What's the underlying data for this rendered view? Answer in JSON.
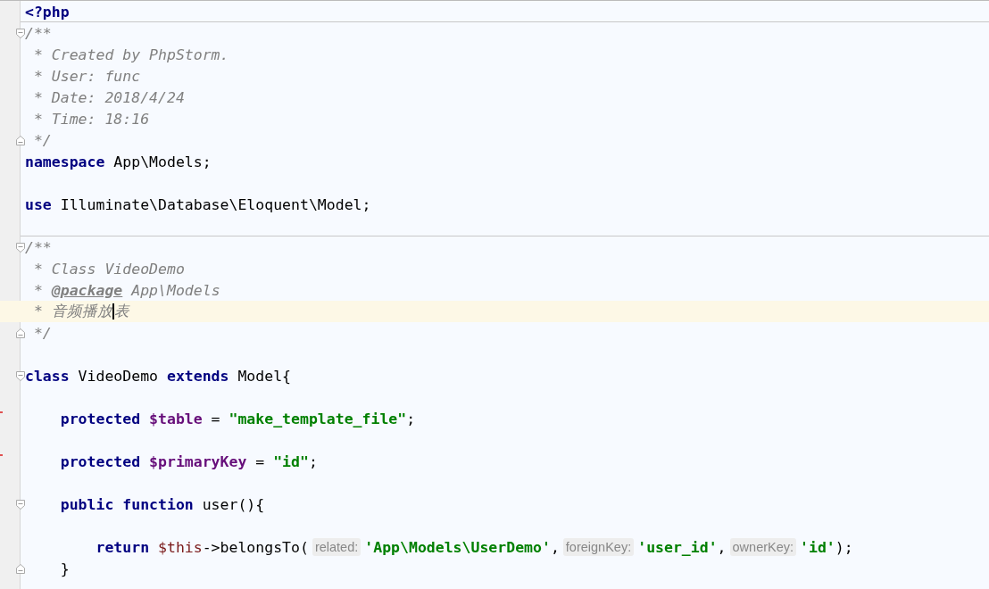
{
  "editor": {
    "lines": [
      {
        "separator_after": true,
        "tokens": [
          {
            "kind": "keyword",
            "text": "<?php"
          }
        ]
      },
      {
        "fold_start": true,
        "tokens": [
          {
            "kind": "comment",
            "text": "/**"
          }
        ]
      },
      {
        "tokens": [
          {
            "kind": "comment",
            "text": " * Created by PhpStorm."
          }
        ]
      },
      {
        "tokens": [
          {
            "kind": "comment",
            "text": " * User: func"
          }
        ]
      },
      {
        "tokens": [
          {
            "kind": "comment",
            "text": " * Date: 2018/4/24"
          }
        ]
      },
      {
        "tokens": [
          {
            "kind": "comment",
            "text": " * Time: 18:16"
          }
        ]
      },
      {
        "fold_end": true,
        "tokens": [
          {
            "kind": "comment",
            "text": " */"
          }
        ]
      },
      {
        "blank_after": true,
        "tokens": [
          {
            "kind": "keyword",
            "text": "namespace"
          },
          {
            "kind": "plain",
            "text": " App\\Models;"
          }
        ]
      },
      {
        "blank_after": true,
        "separator_after": true,
        "tokens": [
          {
            "kind": "keyword",
            "text": "use"
          },
          {
            "kind": "plain",
            "text": " Illuminate\\Database\\Eloquent\\Model;"
          }
        ]
      },
      {
        "fold_start": true,
        "tokens": [
          {
            "kind": "comment",
            "text": "/**"
          }
        ]
      },
      {
        "tokens": [
          {
            "kind": "comment",
            "text": " * Class VideoDemo"
          }
        ]
      },
      {
        "tokens": [
          {
            "kind": "comment",
            "text": " * "
          },
          {
            "kind": "doctag",
            "text": "@package"
          },
          {
            "kind": "comment",
            "text": " App\\Models"
          }
        ]
      },
      {
        "current": true,
        "tokens": [
          {
            "kind": "comment",
            "text": " * 音频播放"
          },
          {
            "kind": "caret"
          },
          {
            "kind": "comment",
            "text": "表"
          }
        ]
      },
      {
        "fold_end": true,
        "blank_after": true,
        "tokens": [
          {
            "kind": "comment",
            "text": " */"
          }
        ]
      },
      {
        "fold_start": true,
        "blank_after": true,
        "tokens": [
          {
            "kind": "keyword",
            "text": "class"
          },
          {
            "kind": "plain",
            "text": " VideoDemo "
          },
          {
            "kind": "keyword",
            "text": "extends"
          },
          {
            "kind": "plain",
            "text": " Model{"
          }
        ]
      },
      {
        "marker": true,
        "blank_after": true,
        "tokens": [
          {
            "kind": "keyword",
            "text": "    protected"
          },
          {
            "kind": "variable",
            "text": " $table"
          },
          {
            "kind": "plain",
            "text": " = "
          },
          {
            "kind": "string",
            "text": "\"make_template_file\""
          },
          {
            "kind": "plain",
            "text": ";"
          }
        ]
      },
      {
        "marker": true,
        "blank_after": true,
        "tokens": [
          {
            "kind": "keyword",
            "text": "    protected"
          },
          {
            "kind": "variable",
            "text": " $primaryKey"
          },
          {
            "kind": "plain",
            "text": " = "
          },
          {
            "kind": "string",
            "text": "\"id\""
          },
          {
            "kind": "plain",
            "text": ";"
          }
        ]
      },
      {
        "fold_start": true,
        "blank_after": true,
        "tokens": [
          {
            "kind": "keyword",
            "text": "    public"
          },
          {
            "kind": "keyword",
            "text": " function"
          },
          {
            "kind": "plain",
            "text": " user(){"
          }
        ]
      },
      {
        "tokens": [
          {
            "kind": "keyword",
            "text": "        return"
          },
          {
            "kind": "this",
            "text": " $this"
          },
          {
            "kind": "plain",
            "text": "->belongsTo("
          },
          {
            "kind": "hint",
            "text": "related:"
          },
          {
            "kind": "string",
            "text": "'App\\Models\\UserDemo'"
          },
          {
            "kind": "plain",
            "text": ","
          },
          {
            "kind": "hint",
            "text": "foreignKey:"
          },
          {
            "kind": "string",
            "text": "'user_id'"
          },
          {
            "kind": "plain",
            "text": ","
          },
          {
            "kind": "hint",
            "text": "ownerKey:"
          },
          {
            "kind": "string",
            "text": "'id'"
          },
          {
            "kind": "plain",
            "text": ");"
          }
        ]
      },
      {
        "fold_end": true,
        "tokens": [
          {
            "kind": "plain",
            "text": "    }"
          }
        ]
      }
    ]
  }
}
